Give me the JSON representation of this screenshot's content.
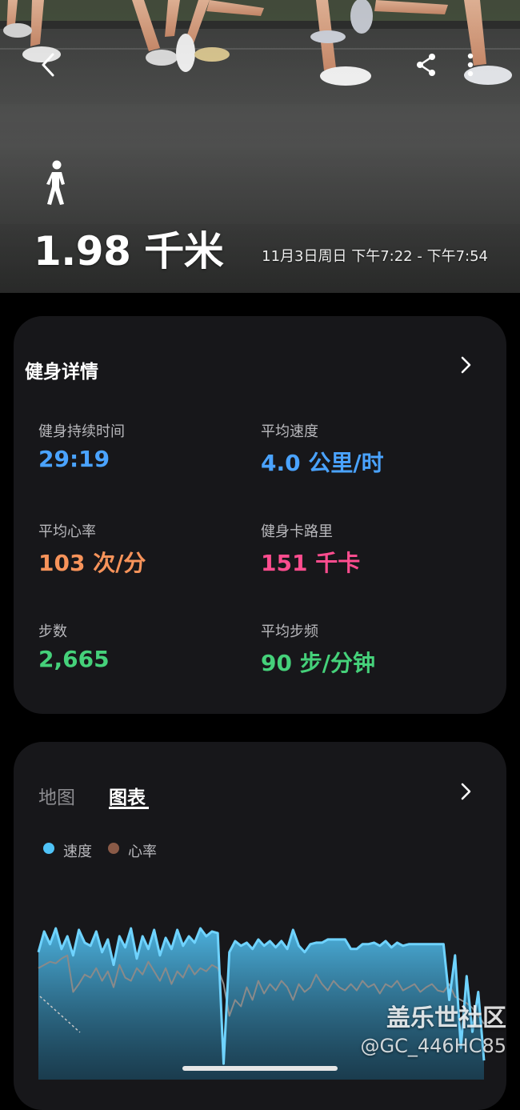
{
  "hero": {
    "distance": "1.98 千米",
    "time_range": "11月3日周日 下午7:22 - 下午7:54",
    "activity_icon": "walk-icon",
    "back_icon": "chevron-left-icon",
    "share_icon": "share-icon",
    "more_icon": "more-vertical-icon"
  },
  "details": {
    "title": "健身详情",
    "metrics": [
      {
        "label": "健身持续时间",
        "value": "29:19",
        "color": "#4aa3ff"
      },
      {
        "label": "平均速度",
        "value": "4.0 公里/时",
        "color": "#4aa3ff"
      },
      {
        "label": "平均心率",
        "value": "103 次/分",
        "color": "#f7935a"
      },
      {
        "label": "健身卡路里",
        "value": "151 千卡",
        "color": "#ff4d8f"
      },
      {
        "label": "步数",
        "value": "2,665",
        "color": "#45d17a"
      },
      {
        "label": "平均步频",
        "value": "90 步/分钟",
        "color": "#45d17a"
      }
    ]
  },
  "chart_card": {
    "tabs": [
      {
        "label": "地图",
        "active": false
      },
      {
        "label": "图表",
        "active": true
      }
    ],
    "legend": [
      {
        "label": "速度",
        "color": "#4fc3f7"
      },
      {
        "label": "心率",
        "color": "#8a5a47"
      }
    ]
  },
  "chart_data": {
    "type": "area",
    "title": "",
    "xlabel": "",
    "ylabel": "",
    "grid": false,
    "legend_position": "top-left",
    "series": [
      {
        "name": "速度",
        "color": "#4fc3f7",
        "values": [
          0.8,
          0.93,
          0.85,
          0.95,
          0.82,
          0.9,
          0.78,
          0.94,
          0.86,
          0.84,
          0.93,
          0.8,
          0.88,
          0.72,
          0.9,
          0.83,
          0.95,
          0.76,
          0.9,
          0.82,
          0.94,
          0.78,
          0.89,
          0.82,
          0.94,
          0.84,
          0.9,
          0.86,
          0.95,
          0.9,
          0.93,
          0.92,
          0.1,
          0.8,
          0.87,
          0.84,
          0.86,
          0.82,
          0.88,
          0.84,
          0.87,
          0.83,
          0.87,
          0.82,
          0.94,
          0.84,
          0.8,
          0.85,
          0.86,
          0.86,
          0.88,
          0.88,
          0.88,
          0.88,
          0.82,
          0.82,
          0.85,
          0.85,
          0.86,
          0.84,
          0.87,
          0.83,
          0.86,
          0.84,
          0.85,
          0.85,
          0.85,
          0.85,
          0.85,
          0.85,
          0.85,
          0.5,
          0.78,
          0.2,
          0.65,
          0.3,
          0.55,
          0.12
        ]
      },
      {
        "name": "心率",
        "color": "#8a8a8a",
        "values": [
          0.7,
          0.72,
          0.74,
          0.73,
          0.76,
          0.78,
          0.55,
          0.6,
          0.66,
          0.64,
          0.7,
          0.62,
          0.68,
          0.58,
          0.72,
          0.64,
          0.62,
          0.7,
          0.66,
          0.74,
          0.68,
          0.62,
          0.7,
          0.6,
          0.68,
          0.64,
          0.72,
          0.66,
          0.7,
          0.68,
          0.72,
          0.7,
          0.6,
          0.4,
          0.5,
          0.46,
          0.58,
          0.5,
          0.62,
          0.54,
          0.6,
          0.56,
          0.62,
          0.58,
          0.5,
          0.6,
          0.55,
          0.58,
          0.66,
          0.6,
          0.56,
          0.62,
          0.58,
          0.56,
          0.6,
          0.56,
          0.62,
          0.58,
          0.6,
          0.54,
          0.6,
          0.58,
          0.62,
          0.56,
          0.58,
          0.6,
          0.55,
          0.58,
          0.6,
          0.56,
          0.55,
          0.6,
          0.52,
          0.5,
          0.48,
          0.45,
          0.4,
          0.35
        ]
      }
    ]
  },
  "watermark": {
    "title": "盖乐世社区",
    "handle": "@GC_446HC85"
  }
}
